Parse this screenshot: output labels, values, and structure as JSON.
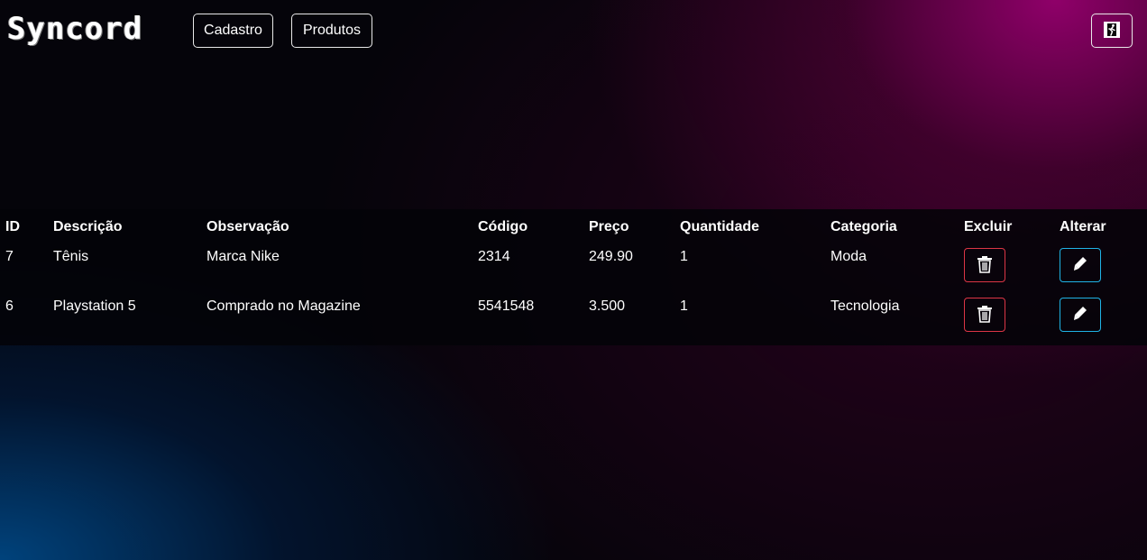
{
  "navbar": {
    "logo_text": "Syncord",
    "links": [
      {
        "label": "Cadastro"
      },
      {
        "label": "Produtos"
      }
    ],
    "logout_icon": "exit-door-icon"
  },
  "table": {
    "headers": [
      "ID",
      "Descrição",
      "Observação",
      "Código",
      "Preço",
      "Quantidade",
      "Categoria",
      "Excluir",
      "Alterar"
    ],
    "rows": [
      {
        "id": "7",
        "descricao": "Tênis",
        "observacao": "Marca Nike",
        "codigo": "2314",
        "preco": "249.90",
        "quantidade": "1",
        "categoria": "Moda"
      },
      {
        "id": "6",
        "descricao": "Playstation 5",
        "observacao": "Comprado no Magazine",
        "codigo": "5541548",
        "preco": "3.500",
        "quantidade": "1",
        "categoria": "Tecnologia"
      }
    ],
    "delete_icon": "trash-icon",
    "edit_icon": "pencil-icon"
  },
  "colors": {
    "delete_border": "#dc3545",
    "edit_border": "#1fb3e6",
    "gradient_magenta": "#96006e",
    "gradient_blue": "#004682"
  }
}
